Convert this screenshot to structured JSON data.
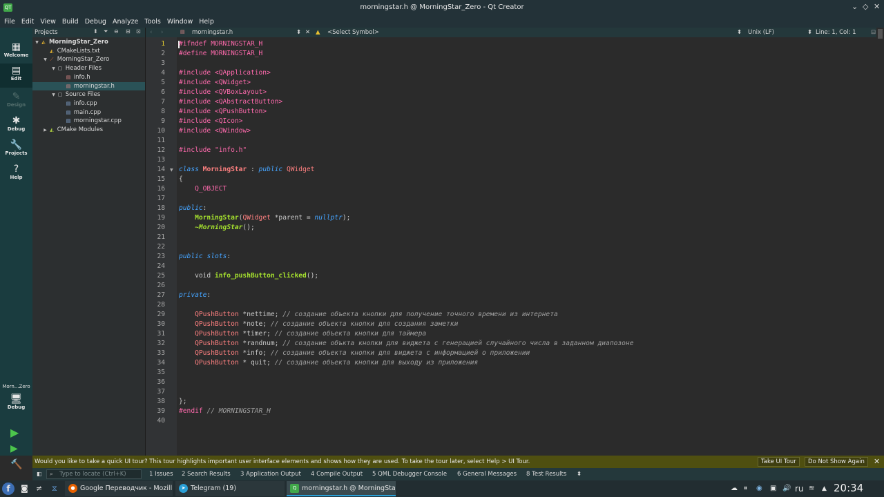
{
  "titlebar": {
    "title": "morningstar.h @ MorningStar_Zero - Qt Creator",
    "app_icon": "QT"
  },
  "menu": [
    "File",
    "Edit",
    "View",
    "Build",
    "Debug",
    "Analyze",
    "Tools",
    "Window",
    "Help"
  ],
  "modes": [
    {
      "label": "Welcome",
      "icon": "grid-icon"
    },
    {
      "label": "Edit",
      "icon": "document-icon"
    },
    {
      "label": "Design",
      "icon": "pen-icon"
    },
    {
      "label": "Debug",
      "icon": "bug-icon"
    },
    {
      "label": "Projects",
      "icon": "wrench-icon"
    },
    {
      "label": "Help",
      "icon": "help-icon"
    }
  ],
  "kit": {
    "name": "Morn...Zero",
    "mode": "Debug"
  },
  "projects_panel": {
    "title": "Projects",
    "tree": [
      {
        "label": "MorningStar_Zero",
        "depth": 0,
        "expanded": true,
        "bold": true,
        "icon": "cmake-project-icon"
      },
      {
        "label": "CMakeLists.txt",
        "depth": 1,
        "icon": "cmake-file-icon"
      },
      {
        "label": "MorningStar_Zero",
        "depth": 1,
        "expanded": true,
        "icon": "target-icon"
      },
      {
        "label": "Header Files",
        "depth": 2,
        "expanded": true,
        "icon": "folder-icon"
      },
      {
        "label": "info.h",
        "depth": 3,
        "icon": "header-file-icon"
      },
      {
        "label": "morningstar.h",
        "depth": 3,
        "selected": true,
        "icon": "header-file-icon"
      },
      {
        "label": "Source Files",
        "depth": 2,
        "expanded": true,
        "icon": "folder-icon"
      },
      {
        "label": "info.cpp",
        "depth": 3,
        "icon": "source-file-icon"
      },
      {
        "label": "main.cpp",
        "depth": 3,
        "icon": "source-file-icon"
      },
      {
        "label": "morningstar.cpp",
        "depth": 3,
        "icon": "source-file-icon"
      },
      {
        "label": "CMake Modules",
        "depth": 1,
        "collapsed": true,
        "icon": "cmake-modules-icon"
      }
    ]
  },
  "editor_toolbar": {
    "file": "morningstar.h",
    "symbol": "<Select Symbol>",
    "line_endings": "Unix (LF)",
    "position": "Line: 1, Col: 1"
  },
  "editor": {
    "current_line": 1,
    "lines": [
      "#ifndef MORNINGSTAR_H",
      "#define MORNINGSTAR_H",
      "",
      "#include <QApplication>",
      "#include <QWidget>",
      "#include <QVBoxLayout>",
      "#include <QAbstractButton>",
      "#include <QPushButton>",
      "#include <QIcon>",
      "#include <QWindow>",
      "",
      "#include \"info.h\"",
      "",
      "class MorningStar : public QWidget",
      "{",
      "    Q_OBJECT",
      "",
      "public:",
      "    MorningStar(QWidget *parent = nullptr);",
      "    ~MorningStar();",
      "",
      "",
      "public slots:",
      "",
      "    void info_pushButton_clicked();",
      "",
      "private:",
      "",
      "    QPushButton *nettime; // создание объекта кнопки для получение точного времени из интернета",
      "    QPushButton *note; // создание объекта кнопки для создания заметки",
      "    QPushButton *timer; // создание объекта кнопки для таймера",
      "    QPushButton *randnum; // создание объкта кнопки для виджета с генерацией случайного числа в заданном диапозоне",
      "    QPushButton *info; // создание объекта кнопки для виджета с информацией о приложении",
      "    QPushButton * quit; // создание объекта кнопки для выходу из приложения",
      "",
      "",
      "",
      "};",
      "#endif // MORNINGSTAR_H",
      ""
    ]
  },
  "info_bar": {
    "message": "Would you like to take a quick UI tour? This tour highlights important user interface elements and shows how they are used. To take the tour later, select Help > UI Tour.",
    "take_tour": "Take UI Tour",
    "dismiss": "Do Not Show Again"
  },
  "output_bar": {
    "locate_placeholder": "Type to locate (Ctrl+K)",
    "panes": [
      "1  Issues",
      "2  Search Results",
      "3  Application Output",
      "4  Compile Output",
      "5  QML Debugger Console",
      "6  General Messages",
      "8  Test Results"
    ]
  },
  "taskbar": {
    "windows": [
      {
        "label": "Google Переводчик - Mozill...",
        "icon": "firefox-icon",
        "color": "#e66000"
      },
      {
        "label": "Telegram (19)",
        "icon": "telegram-icon",
        "color": "#2a9fd6"
      },
      {
        "label": "morningstar.h @ MorningSta...",
        "icon": "qtcreator-icon",
        "color": "#41a84a",
        "active": true
      }
    ],
    "layout": "ru",
    "clock": "20:34"
  }
}
